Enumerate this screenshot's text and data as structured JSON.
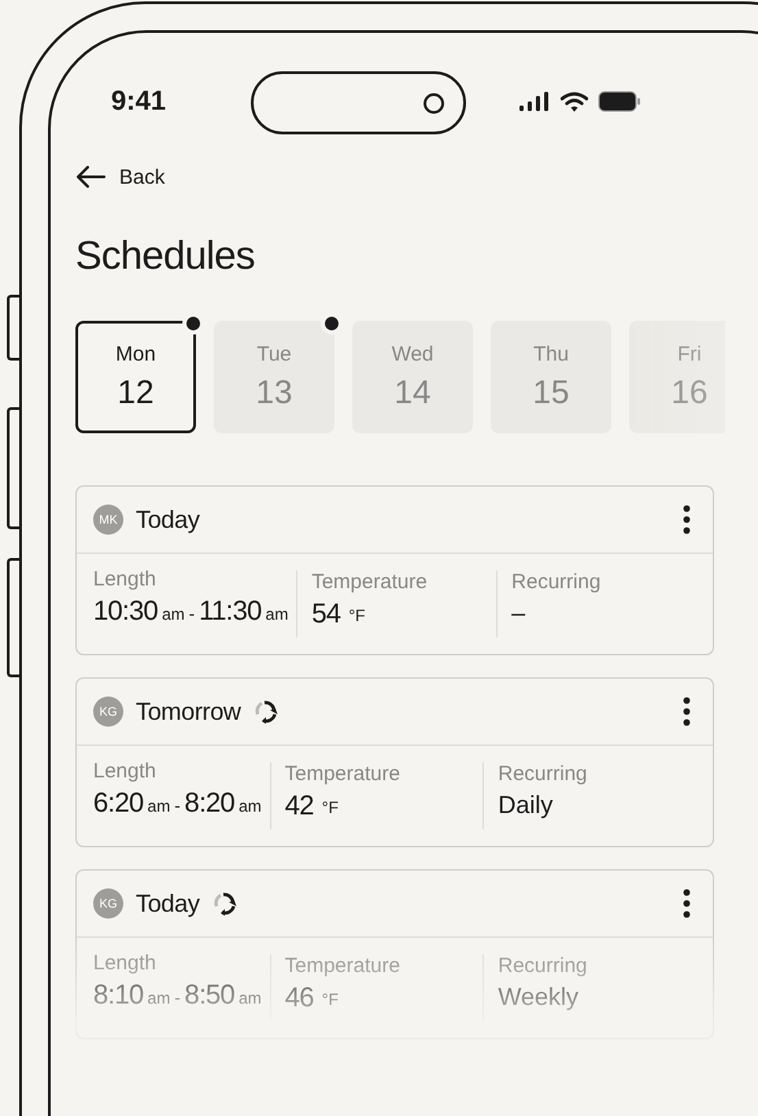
{
  "status_bar": {
    "time": "9:41"
  },
  "nav": {
    "back": "Back"
  },
  "title": "Schedules",
  "days": [
    {
      "weekday": "Mon",
      "date": "12",
      "selected": true,
      "has_event": true
    },
    {
      "weekday": "Tue",
      "date": "13",
      "selected": false,
      "has_event": true
    },
    {
      "weekday": "Wed",
      "date": "14",
      "selected": false,
      "has_event": false
    },
    {
      "weekday": "Thu",
      "date": "15",
      "selected": false,
      "has_event": false
    },
    {
      "weekday": "Fri",
      "date": "16",
      "selected": false,
      "has_event": false
    }
  ],
  "schedules": [
    {
      "initials": "MK",
      "title": "Today",
      "repeat": false,
      "length_label": "Length",
      "start": "10:30",
      "start_suffix": "am",
      "dash": "-",
      "end": "11:30",
      "end_suffix": "am",
      "temperature_label": "Temperature",
      "temperature": "54",
      "unit": "°F",
      "recurring_label": "Recurring",
      "recurring": "–"
    },
    {
      "initials": "KG",
      "title": "Tomorrow",
      "repeat": true,
      "length_label": "Length",
      "start": "6:20",
      "start_suffix": "am",
      "dash": "-",
      "end": "8:20",
      "end_suffix": "am",
      "temperature_label": "Temperature",
      "temperature": "42",
      "unit": "°F",
      "recurring_label": "Recurring",
      "recurring": "Daily"
    },
    {
      "initials": "KG",
      "title": "Today",
      "repeat": true,
      "length_label": "Length",
      "start": "8:10",
      "start_suffix": "am",
      "dash": "-",
      "end": "8:50",
      "end_suffix": "am",
      "temperature_label": "Temperature",
      "temperature": "46",
      "unit": "°F",
      "recurring_label": "Recurring",
      "recurring": "Weekly"
    }
  ]
}
